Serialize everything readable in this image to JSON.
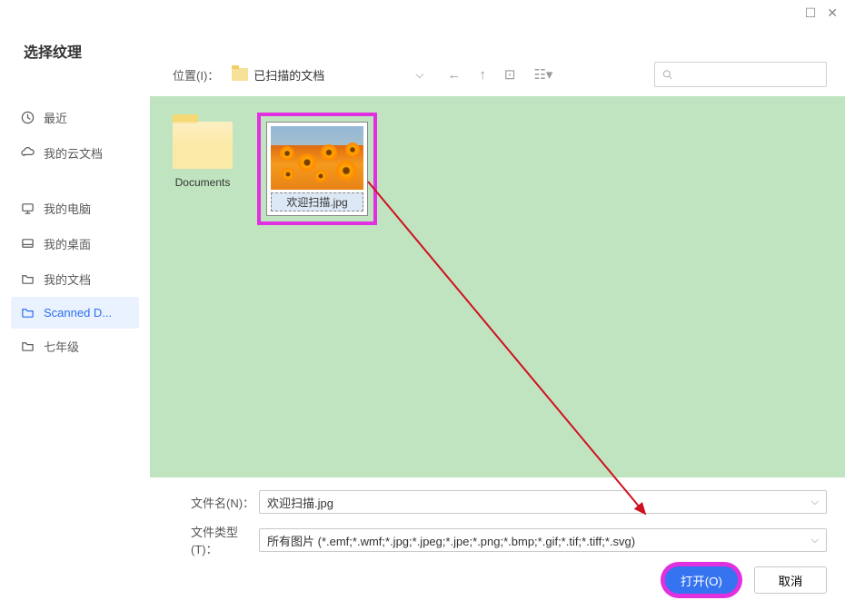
{
  "window": {
    "maximize": "☐",
    "close": "✕"
  },
  "dialog": {
    "title": "选择纹理"
  },
  "toolbar": {
    "location_label": "位置(I)：",
    "current_path": "已扫描的文档",
    "search_placeholder": ""
  },
  "sidebar": {
    "items": [
      {
        "icon": "clock",
        "label": "最近"
      },
      {
        "icon": "cloud",
        "label": "我的云文档"
      },
      {
        "icon": "monitor",
        "label": "我的电脑"
      },
      {
        "icon": "desktop",
        "label": "我的桌面"
      },
      {
        "icon": "folder",
        "label": "我的文档"
      },
      {
        "icon": "folder",
        "label": "Scanned D..."
      },
      {
        "icon": "folder",
        "label": "七年级"
      }
    ],
    "selected_index": 5,
    "gap_after_index": 1
  },
  "files": {
    "items": [
      {
        "type": "folder",
        "name": "Documents"
      },
      {
        "type": "image",
        "name": "欢迎扫描.jpg"
      }
    ],
    "selected_index": 1
  },
  "bottom": {
    "filename_label": "文件名(N)：",
    "filename_value": "欢迎扫描.jpg",
    "filetype_label": "文件类型(T)：",
    "filetype_value": "所有图片 (*.emf;*.wmf;*.jpg;*.jpeg;*.jpe;*.png;*.bmp;*.gif;*.tif;*.tiff;*.svg)",
    "open_label": "打开(O)",
    "cancel_label": "取消"
  },
  "annotation": {
    "highlight_color": "#e030e0",
    "arrow_color": "#d01020"
  }
}
